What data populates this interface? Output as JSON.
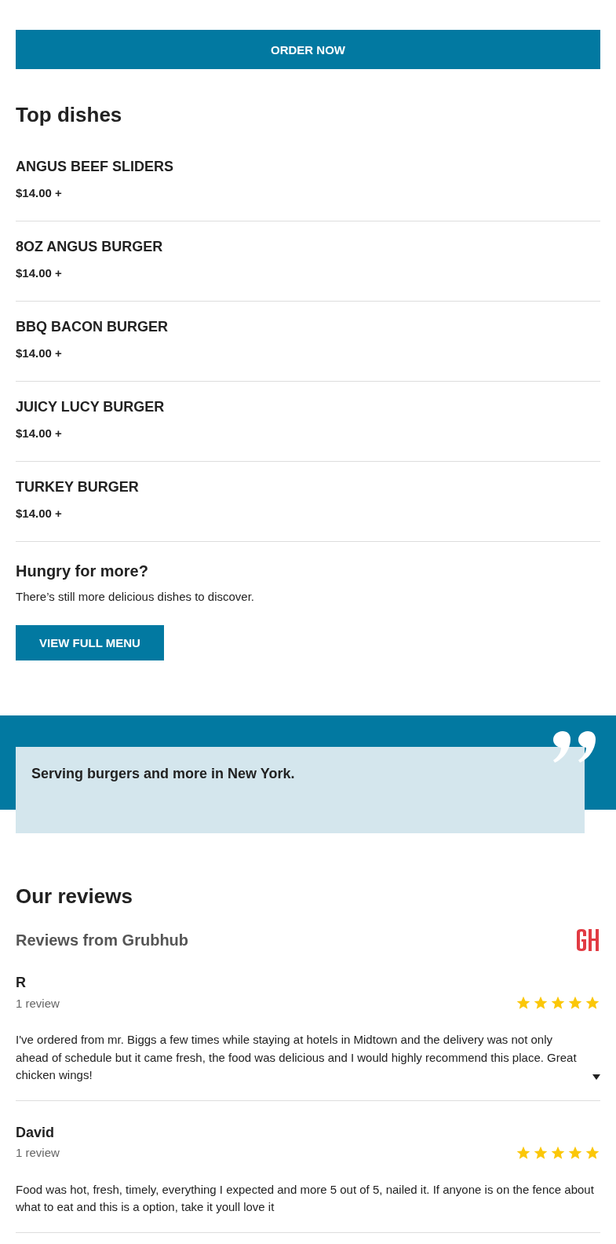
{
  "order_button": "ORDER NOW",
  "top_dishes": {
    "title": "Top dishes",
    "items": [
      {
        "name": "ANGUS BEEF SLIDERS",
        "price": "$14.00 +"
      },
      {
        "name": "8OZ ANGUS BURGER",
        "price": "$14.00 +"
      },
      {
        "name": "BBQ BACON BURGER",
        "price": "$14.00 +"
      },
      {
        "name": "JUICY LUCY BURGER",
        "price": "$14.00 +"
      },
      {
        "name": "TURKEY BURGER",
        "price": "$14.00 +"
      }
    ]
  },
  "more": {
    "title": "Hungry for more?",
    "text": "There’s still more delicious dishes to discover.",
    "button": "VIEW FULL MENU"
  },
  "quote": "Serving burgers and more in New York.",
  "reviews": {
    "title": "Our reviews",
    "source": "Reviews from Grubhub",
    "items": [
      {
        "name": "R",
        "count": "1 review",
        "stars": 5,
        "text": "I've ordered from mr. Biggs a few times while staying at hotels in Midtown and the delivery was not only ahead of schedule but it came fresh, the food was delicious and I would highly recommend this place. Great chicken wings!",
        "expandable": true
      },
      {
        "name": "David",
        "count": "1 review",
        "stars": 5,
        "text": "Food was hot, fresh, timely, everything I expected and more 5 out of 5, nailed it. If anyone is on the fence about what to eat and this is a option, take it youll love it",
        "expandable": false
      }
    ]
  }
}
